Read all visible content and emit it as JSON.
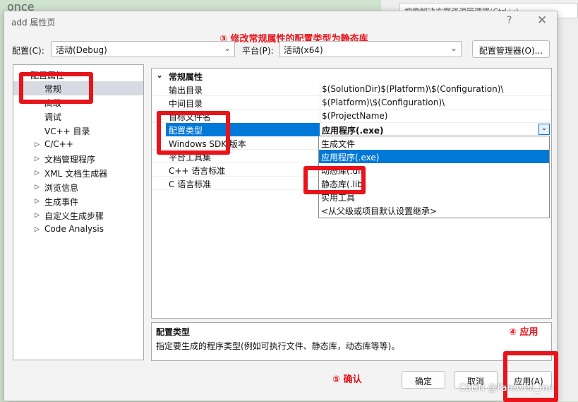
{
  "background": {
    "editor_text": "once",
    "search_placeholder": "搜索解决方案资源管理器(Ctrl+;)"
  },
  "dialog": {
    "title": "add 属性页",
    "help": "?",
    "close": "✕"
  },
  "annotations": {
    "step3": "③ 修改常规属性的配置类型为静态库",
    "step4": "④ 应用",
    "step5": "⑤ 确认",
    "color": "#e8141b"
  },
  "config": {
    "label": "配置(C):",
    "value": "活动(Debug)",
    "platform_label": "平台(P):",
    "platform_value": "活动(x64)",
    "manager_button": "配置管理器(O)..."
  },
  "tree": {
    "root": "配置属性",
    "items": [
      {
        "label": "常规",
        "selected": true,
        "expandable": false
      },
      {
        "label": "高级",
        "expandable": false
      },
      {
        "label": "调试",
        "expandable": false
      },
      {
        "label": "VC++ 目录",
        "expandable": false
      },
      {
        "label": "C/C++",
        "expandable": true
      },
      {
        "label": "文档管理程序",
        "expandable": true
      },
      {
        "label": "XML 文档生成器",
        "expandable": true
      },
      {
        "label": "浏览信息",
        "expandable": true
      },
      {
        "label": "生成事件",
        "expandable": true
      },
      {
        "label": "自定义生成步骤",
        "expandable": true
      },
      {
        "label": "Code Analysis",
        "expandable": true
      }
    ]
  },
  "grid": {
    "section": "常规属性",
    "rows": [
      {
        "name": "输出目录",
        "value": "$(SolutionDir)$(Platform)\\$(Configuration)\\"
      },
      {
        "name": "中间目录",
        "value": "$(Platform)\\$(Configuration)\\"
      },
      {
        "name": "目标文件名",
        "value": "$(ProjectName)"
      },
      {
        "name": "配置类型",
        "value": "应用程序(.exe)",
        "selected": true
      },
      {
        "name": "Windows SDK 版本",
        "value": ""
      },
      {
        "name": "平台工具集",
        "value": ""
      },
      {
        "name": "C++ 语言标准",
        "value": ""
      },
      {
        "name": "C 语言标准",
        "value": ""
      }
    ]
  },
  "dropdown": {
    "options": [
      "生成文件",
      "应用程序(.exe)",
      "动态库(.dll)",
      "静态库(.lib)",
      "实用工具",
      "<从父级或项目默认设置继承>"
    ],
    "highlighted": "应用程序(.exe)"
  },
  "description": {
    "title": "配置类型",
    "text": "指定要生成的程序类型(例如可执行文件、静态库，动态库等等)。"
  },
  "buttons": {
    "ok": "确定",
    "cancel": "取消",
    "apply": "应用(A)"
  },
  "watermark": "CSDN @Farewell_me"
}
